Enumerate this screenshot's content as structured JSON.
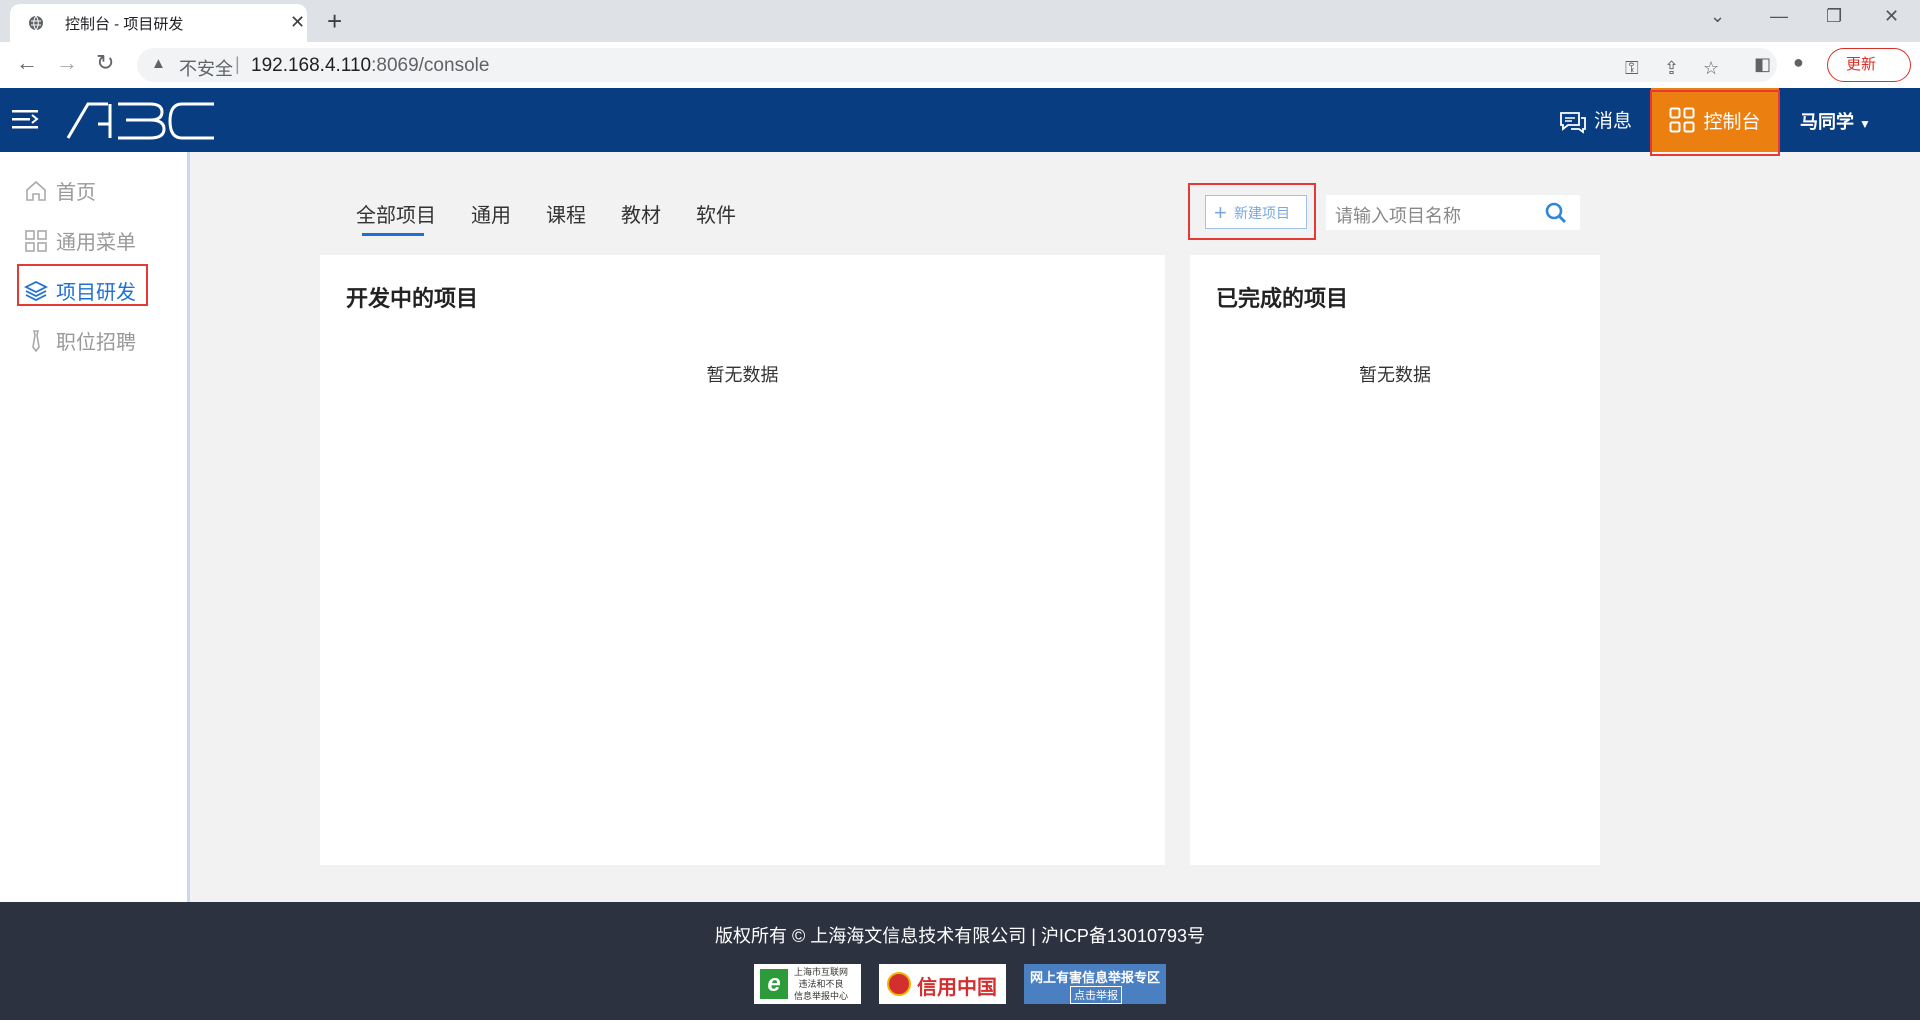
{
  "browser": {
    "tab_title": "控制台 - 项目研发",
    "insecure_label": "不安全",
    "url_host": "192.168.4.110",
    "url_rest": ":8069/console",
    "update_label": "更新"
  },
  "header": {
    "logo_text": "ABC",
    "messages_label": "消息",
    "console_label": "控制台",
    "user_name": "马同学"
  },
  "sidebar": {
    "items": [
      {
        "label": "首页"
      },
      {
        "label": "通用菜单"
      },
      {
        "label": "项目研发"
      },
      {
        "label": "职位招聘"
      }
    ]
  },
  "tabs": [
    "全部项目",
    "通用",
    "课程",
    "教材",
    "软件"
  ],
  "toolbar": {
    "new_project_label": "新建项目",
    "search_placeholder": "请输入项目名称"
  },
  "panels": {
    "in_progress_title": "开发中的项目",
    "in_progress_empty": "暂无数据",
    "completed_title": "已完成的项目",
    "completed_empty": "暂无数据"
  },
  "footer": {
    "copyright": "版权所有 © 上海海文信息技术有限公司 | 沪ICP备13010793号",
    "badge1_line1": "上海市互联网",
    "badge1_line2": "违法和不良",
    "badge1_line3": "信息举报中心",
    "badge2_text": "信用中国",
    "badge3_line1": "网上有害信息举报专区",
    "badge3_line2": "点击举报"
  },
  "colors": {
    "header_bg": "#083d82",
    "console_bg": "#eb7f10",
    "accent": "#1e6fd6",
    "footer_bg": "#2d3241"
  }
}
